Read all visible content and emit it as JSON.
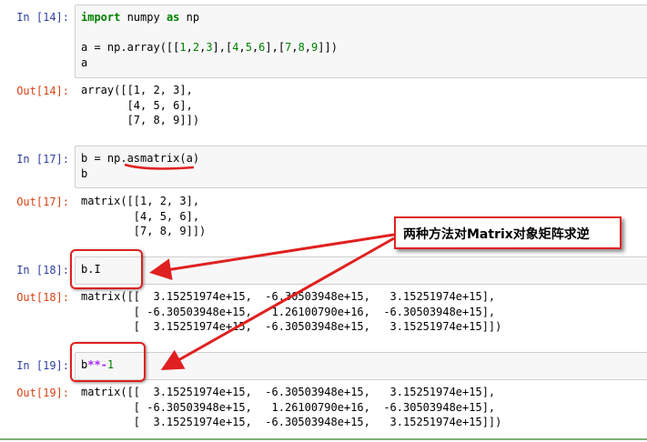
{
  "cells": [
    {
      "in_prompt": "In [14]:",
      "code_lines": [
        [
          {
            "t": "import",
            "c": "kw"
          },
          {
            "t": " numpy ",
            "c": ""
          },
          {
            "t": "as",
            "c": "kw"
          },
          {
            "t": " np",
            "c": ""
          }
        ],
        [],
        [
          {
            "t": "a = np.array([[",
            "c": ""
          },
          {
            "t": "1",
            "c": "num"
          },
          {
            "t": ",",
            "c": ""
          },
          {
            "t": "2",
            "c": "num"
          },
          {
            "t": ",",
            "c": ""
          },
          {
            "t": "3",
            "c": "num"
          },
          {
            "t": "],[",
            "c": ""
          },
          {
            "t": "4",
            "c": "num"
          },
          {
            "t": ",",
            "c": ""
          },
          {
            "t": "5",
            "c": "num"
          },
          {
            "t": ",",
            "c": ""
          },
          {
            "t": "6",
            "c": "num"
          },
          {
            "t": "],[",
            "c": ""
          },
          {
            "t": "7",
            "c": "num"
          },
          {
            "t": ",",
            "c": ""
          },
          {
            "t": "8",
            "c": "num"
          },
          {
            "t": ",",
            "c": ""
          },
          {
            "t": "9",
            "c": "num"
          },
          {
            "t": "]])",
            "c": ""
          }
        ],
        [
          {
            "t": "a",
            "c": ""
          }
        ]
      ],
      "out_prompt": "Out[14]:",
      "output": "array([[1, 2, 3],\n       [4, 5, 6],\n       [7, 8, 9]])"
    },
    {
      "in_prompt": "In [17]:",
      "code_lines": [
        [
          {
            "t": "b = np.asmatrix(a)",
            "c": ""
          }
        ],
        [
          {
            "t": "b",
            "c": ""
          }
        ]
      ],
      "out_prompt": "Out[17]:",
      "output": "matrix([[1, 2, 3],\n        [4, 5, 6],\n        [7, 8, 9]])"
    },
    {
      "in_prompt": "In [18]:",
      "code_lines": [
        [
          {
            "t": "b.I",
            "c": ""
          }
        ]
      ],
      "out_prompt": "Out[18]:",
      "output": "matrix([[  3.15251974e+15,  -6.30503948e+15,   3.15251974e+15],\n        [ -6.30503948e+15,   1.26100790e+16,  -6.30503948e+15],\n        [  3.15251974e+15,  -6.30503948e+15,   3.15251974e+15]])"
    },
    {
      "in_prompt": "In [19]:",
      "code_lines": [
        [
          {
            "t": "b",
            "c": ""
          },
          {
            "t": "**-",
            "c": "op"
          },
          {
            "t": "1",
            "c": "num"
          }
        ]
      ],
      "out_prompt": "Out[19]:",
      "output": "matrix([[  3.15251974e+15,  -6.30503948e+15,   3.15251974e+15],\n        [ -6.30503948e+15,   1.26100790e+16,  -6.30503948e+15],\n        [  3.15251974e+15,  -6.30503948e+15,   3.15251974e+15]])"
    }
  ],
  "annotation": {
    "callout_text": "两种方法对Matrix对象矩阵求逆",
    "color": "#e02020"
  }
}
